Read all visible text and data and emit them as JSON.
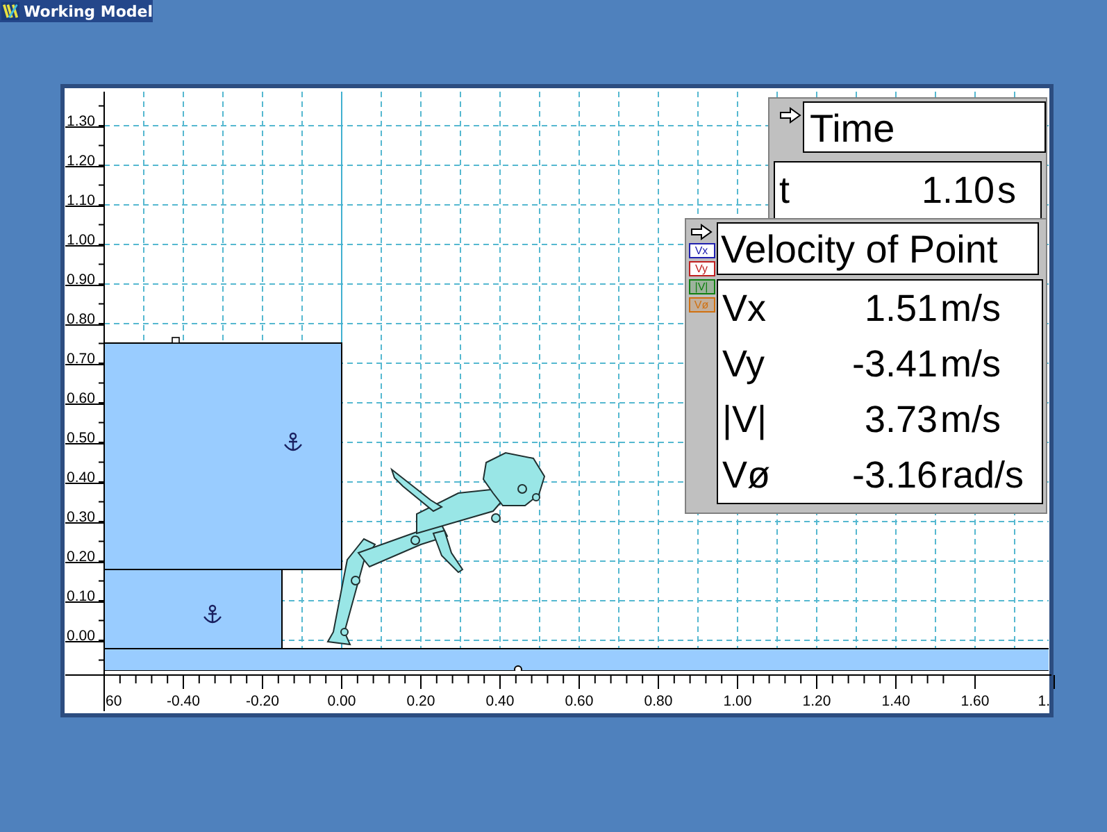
{
  "window": {
    "title": "Working Model"
  },
  "plot": {
    "y_ticks": [
      "1.30",
      "1.20",
      "1.10",
      "1.00",
      "0.90",
      "0.80",
      "0.70",
      "0.60",
      "0.50",
      "0.40",
      "0.30",
      "0.20",
      "0.10",
      "0.00"
    ],
    "x_ticks": [
      "60",
      "-0.40",
      "-0.20",
      "0.00",
      "0.20",
      "0.40",
      "0.60",
      "0.80",
      "1.00",
      "1.20",
      "1.40",
      "1.60",
      "1."
    ]
  },
  "meters": [
    {
      "kind": "time",
      "title": "Time",
      "rows": [
        {
          "label": "t",
          "value": "1.10",
          "unit": "s"
        }
      ]
    },
    {
      "kind": "velocity",
      "title": "Velocity of Point",
      "legend": [
        {
          "label": "Vx",
          "color": "#1f1fb0"
        },
        {
          "label": "Vy",
          "color": "#c02020"
        },
        {
          "label": "|V|",
          "color": "#108010"
        },
        {
          "label": "Vø",
          "color": "#d07010"
        }
      ],
      "rows": [
        {
          "label": "Vx",
          "value": "1.51",
          "unit": "m/s"
        },
        {
          "label": "Vy",
          "value": "-3.41",
          "unit": "m/s"
        },
        {
          "label": "|V|",
          "value": "3.73",
          "unit": "m/s"
        },
        {
          "label": "Vø",
          "value": "-3.16",
          "unit": "rad/s"
        }
      ]
    }
  ]
}
